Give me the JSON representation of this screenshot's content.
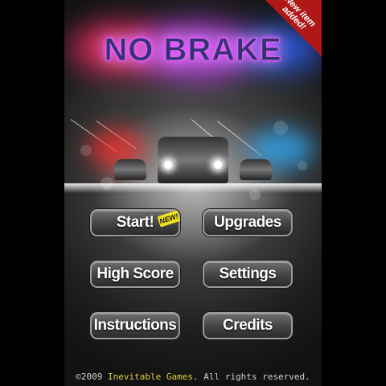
{
  "game": {
    "title": "NO BRAKE"
  },
  "ribbon": {
    "text": "New item\nadded!",
    "color": "#b01818"
  },
  "menu": {
    "start_label": "Start!",
    "start_badge": "NEW!",
    "upgrades_label": "Upgrades",
    "high_score_label": "High Score",
    "settings_label": "Settings",
    "instructions_label": "Instructions",
    "credits_label": "Credits"
  },
  "footer": {
    "copyright": "©2009 ",
    "company": "Inevitable Games",
    "rights": ". All rights reserved."
  },
  "colors": {
    "title_glow_left": "#ff2a4a",
    "title_glow_mid": "#d050ff",
    "title_glow_right": "#3060ff",
    "police_red": "#ff3030",
    "police_blue": "#30b0ff",
    "badge": "#f0e020"
  }
}
